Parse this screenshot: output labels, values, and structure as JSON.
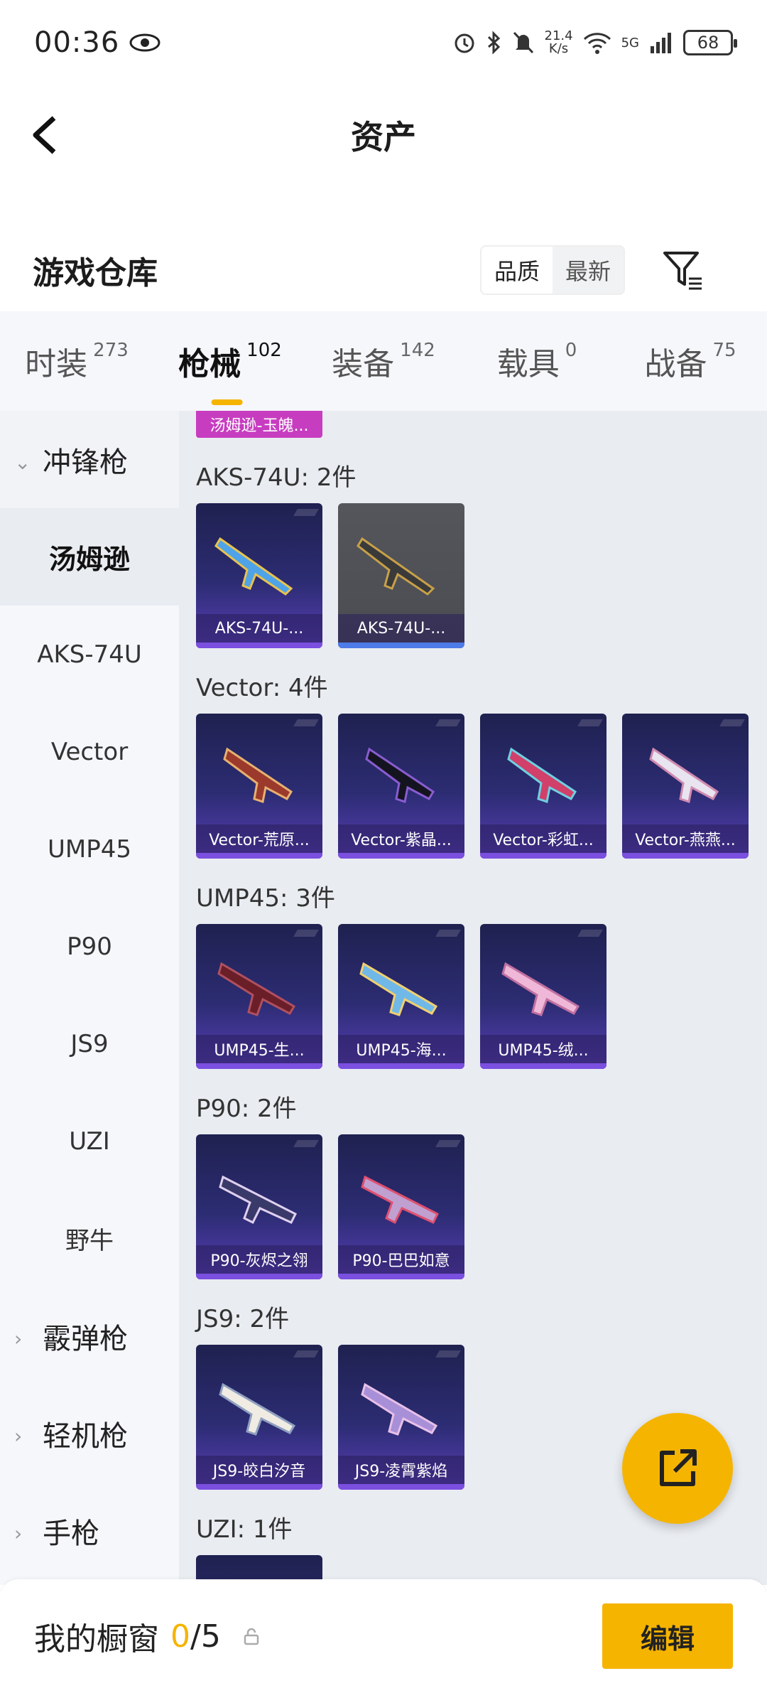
{
  "status": {
    "time": "00:36",
    "speed_value": "21.4",
    "speed_unit": "K/s",
    "network": "5G",
    "battery": "68"
  },
  "nav": {
    "title": "资产"
  },
  "warehouse": {
    "title": "游戏仓库",
    "sort_quality": "品质",
    "sort_newest": "最新"
  },
  "tabs": [
    {
      "label": "时装",
      "count": "273"
    },
    {
      "label": "枪械",
      "count": "102"
    },
    {
      "label": "装备",
      "count": "142"
    },
    {
      "label": "载具",
      "count": "0"
    },
    {
      "label": "战备",
      "count": "75"
    }
  ],
  "sidebar": {
    "smg": "冲锋枪",
    "items": [
      "汤姆逊",
      "AKS-74U",
      "Vector",
      "UMP45",
      "P90",
      "JS9",
      "UZI",
      "野牛"
    ],
    "shotgun": "霰弹枪",
    "lmg": "轻机枪",
    "pistol": "手枪"
  },
  "content": {
    "top_chip": "汤姆逊-玉魄...",
    "sections": [
      {
        "title": "AKS-74U: 2件",
        "items": [
          "AKS-74U-...",
          "AKS-74U-..."
        ]
      },
      {
        "title": "Vector: 4件",
        "items": [
          "Vector-荒原...",
          "Vector-紫晶...",
          "Vector-彩虹...",
          "Vector-燕燕..."
        ]
      },
      {
        "title": "UMP45: 3件",
        "items": [
          "UMP45-生...",
          "UMP45-海...",
          "UMP45-绒..."
        ]
      },
      {
        "title": "P90: 2件",
        "items": [
          "P90-灰烬之翎",
          "P90-巴巴如意"
        ]
      },
      {
        "title": "JS9: 2件",
        "items": [
          "JS9-皎白汐音",
          "JS9-凌霄紫焰"
        ]
      },
      {
        "title": "UZI: 1件"
      }
    ]
  },
  "bottom": {
    "label": "我的橱窗",
    "used": "0",
    "total": "/5",
    "edit": "编辑"
  },
  "colors": {
    "accent": "#f5b400",
    "card_purple": "#2c2c73",
    "sidebar_bg": "#f5f7fb"
  }
}
